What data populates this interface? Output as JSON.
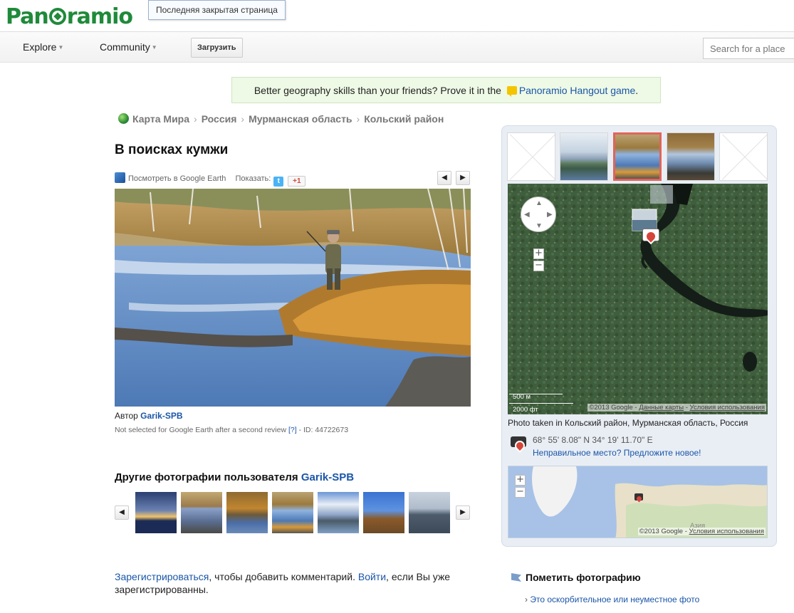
{
  "header": {
    "logo_text": "Panoramio",
    "tooltip": "Последняя закрытая страница",
    "nav": {
      "explore": "Explore",
      "community": "Community",
      "upload": "Загрузить"
    },
    "search_placeholder": "Search for a place"
  },
  "promo": {
    "text": "Better geography skills than your friends? Prove it in the",
    "link": "Panoramio Hangout game",
    "suffix": "."
  },
  "breadcrumb": [
    "Карта Мира",
    "Россия",
    "Мурманская область",
    "Кольский район"
  ],
  "photo": {
    "title": "В поисках кумжи",
    "google_earth": "Посмотреть в Google Earth",
    "show_label": "Показать:",
    "gplus": "+1",
    "author_label": "Автор",
    "author": "Garik-SPB",
    "review_text": "Not selected for Google Earth after a second review",
    "review_help": "[?]",
    "id_text": "- ID: 44722673"
  },
  "other_photos": {
    "title": "Другие фотографии пользователя",
    "user": "Garik-SPB"
  },
  "comment": {
    "register": "Зарегистрироваться",
    "mid": ", чтобы добавить комментарий. ",
    "login": "Войти",
    "end": ", если Вы уже зарегистрированны."
  },
  "map": {
    "scale_m": "500 м",
    "scale_ft": "2000 фт",
    "copyright": "©2013 Google -",
    "map_data": "Данные карты",
    "terms": "Условия использования",
    "photo_taken": "Photo taken in Кольский район, Мурманская область, Россия",
    "coords": "68° 55' 8.08\" N  34° 19' 11.70\" E",
    "suggest": "Неправильное место? Предложите новое!",
    "mini_copyright": "©2013 Google -",
    "mini_terms": "Условия использования",
    "mini_label": "Азия"
  },
  "flag": {
    "title": "Пометить фотографию",
    "link": "Это оскорбительное или неуместное фото"
  },
  "colors": {
    "brand": "#1f8a3a",
    "link": "#1a56a8",
    "selected": "#e0645a"
  }
}
